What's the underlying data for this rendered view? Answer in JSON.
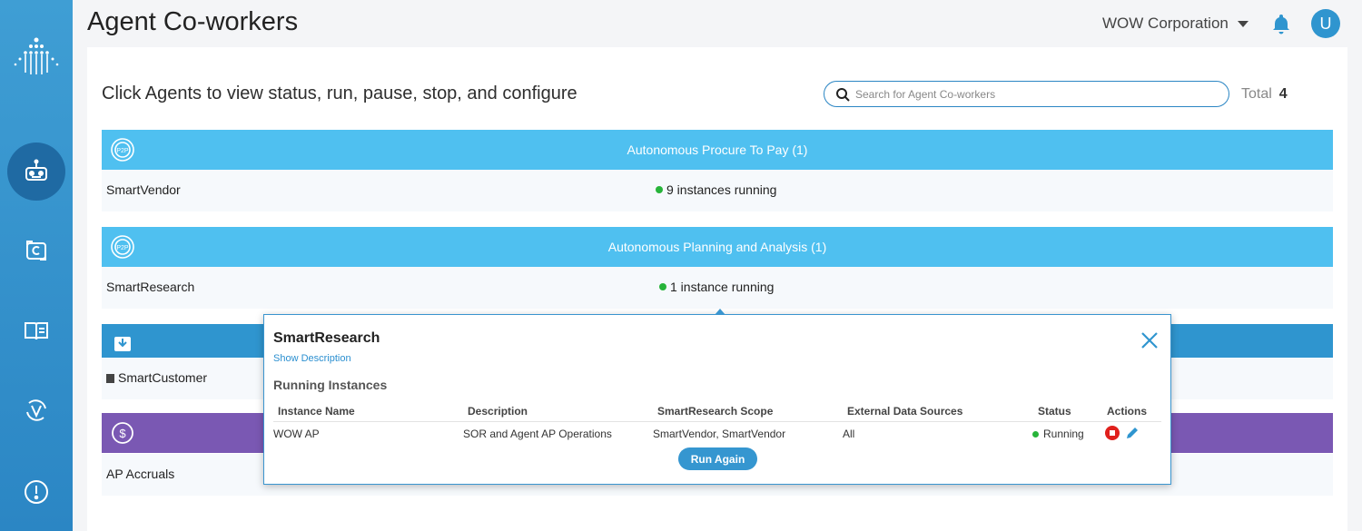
{
  "header": {
    "title": "Agent Co-workers",
    "org": "WOW Corporation",
    "avatar_letter": "U"
  },
  "main": {
    "subtitle": "Click Agents to view status, run, pause, stop, and configure",
    "search_placeholder": "Search for Agent Co-workers",
    "total_label": "Total",
    "total_value": "4"
  },
  "groups": [
    {
      "title": "Autonomous Procure To Pay (1)",
      "color": "#4fc0f0",
      "icon": "p2p-icon",
      "agent": "SmartVendor",
      "status": "9 instances running"
    },
    {
      "title": "Autonomous Planning and Analysis (1)",
      "color": "#4fc0f0",
      "icon": "p2p-icon",
      "agent": "SmartResearch",
      "status": "1 instance running"
    },
    {
      "title": "",
      "color": "#2f95cf",
      "icon": "download-box-icon",
      "agent": "SmartCustomer",
      "status": ""
    },
    {
      "title": "",
      "color": "#7a58b3",
      "icon": "dollar-cycle-icon",
      "agent": "AP Accruals",
      "status": ""
    }
  ],
  "popup": {
    "title": "SmartResearch",
    "show_description": "Show Description",
    "section": "Running Instances",
    "columns": [
      "Instance Name",
      "Description",
      "SmartResearch Scope",
      "External Data Sources",
      "Status",
      "Actions"
    ],
    "row": [
      "WOW AP",
      "SOR and Agent AP Operations",
      "SmartVendor, SmartVendor",
      "All",
      "Running"
    ],
    "run_again": "Run Again"
  },
  "colors": {
    "sidebar": "#2b86c4",
    "accent": "#3596d0",
    "running": "#27b43a",
    "stop": "#e0201c"
  }
}
